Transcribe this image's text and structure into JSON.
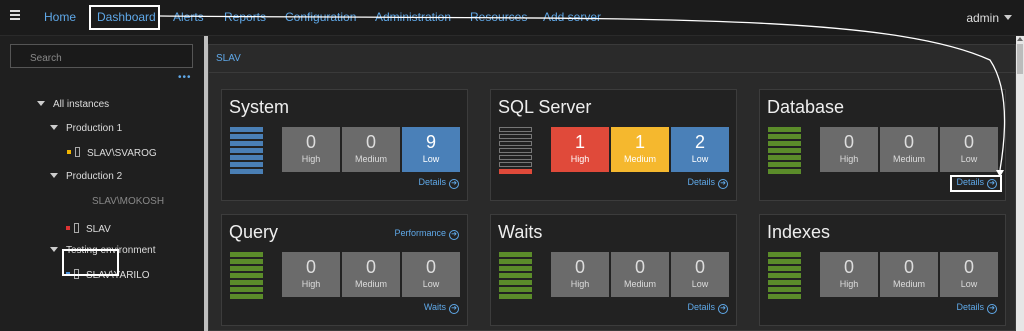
{
  "topbar": {
    "nav": [
      "Home",
      "Dashboard",
      "Alerts",
      "Reports",
      "Configuration",
      "Administration",
      "Resources",
      "Add server"
    ],
    "active": "Dashboard",
    "user": "admin"
  },
  "sidebar": {
    "search_placeholder": "Search",
    "more": "•••",
    "tree": [
      {
        "label": "All instances",
        "kind": "group"
      },
      {
        "label": "Production 1",
        "kind": "group"
      },
      {
        "label": "SLAV\\SVAROG",
        "kind": "server",
        "status_color": "#f0b400"
      },
      {
        "label": "Production 2",
        "kind": "group"
      },
      {
        "label": "SLAV\\MOKOSH",
        "kind": "server-disabled"
      },
      {
        "label": "SLAV",
        "kind": "server",
        "status_color": "#d33"
      },
      {
        "label": "Testing environment",
        "kind": "group"
      },
      {
        "label": "SLAV\\YARILO",
        "kind": "server",
        "status_color": "#4a90d9"
      }
    ]
  },
  "main": {
    "title": "SLAV",
    "severity_labels": [
      "High",
      "Medium",
      "Low"
    ],
    "cards": [
      {
        "title": "System",
        "link": "Details",
        "values": [
          "0",
          "0",
          "9"
        ],
        "bar_color": "#4a7fb5",
        "bar_count": 7,
        "bar_red": 0
      },
      {
        "title": "SQL Server",
        "link": "Details",
        "values": [
          "1",
          "1",
          "2"
        ],
        "bar_color": "#222",
        "bar_count": 7,
        "bar_red": 1
      },
      {
        "title": "Database",
        "link": "Details",
        "values": [
          "0",
          "0",
          "0"
        ],
        "bar_color": "#5b8c2a",
        "bar_count": 7,
        "bar_red": 0
      },
      {
        "title": "Query",
        "link": "Waits",
        "extra_link": "Performance",
        "values": [
          "0",
          "0",
          "0"
        ],
        "bar_color": "#5b8c2a",
        "bar_count": 7,
        "bar_red": 0
      },
      {
        "title": "Waits",
        "link": "Details",
        "values": [
          "0",
          "0",
          "0"
        ],
        "bar_color": "#5b8c2a",
        "bar_count": 7,
        "bar_red": 0
      },
      {
        "title": "Indexes",
        "link": "Details",
        "values": [
          "0",
          "0",
          "0"
        ],
        "bar_color": "#5b8c2a",
        "bar_count": 7,
        "bar_red": 0
      }
    ],
    "colors": {
      "grey": "#6b6b6b",
      "high": "#e04a3a",
      "medium": "#f5b82e",
      "low": "#4a80b8",
      "accent": "#5fa8e8"
    }
  }
}
